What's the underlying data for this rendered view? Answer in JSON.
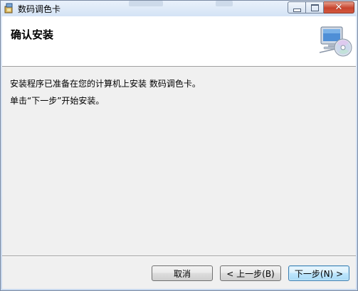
{
  "window": {
    "title": "数码调色卡",
    "controls": {
      "minimize_icon": "minimize-icon",
      "maximize_icon": "maximize-icon",
      "close_icon": "close-icon",
      "close_glyph": "✕"
    }
  },
  "banner": {
    "title": "确认安装",
    "icon": "computer-cd-icon"
  },
  "body": {
    "line1": "安装程序已准备在您的计算机上安装 数码调色卡。",
    "line2": "单击“下一步”开始安装。"
  },
  "buttons": {
    "cancel": "取消",
    "back": "< 上一步(B)",
    "next": "下一步(N) >"
  },
  "colors": {
    "titlebar": "#d4e3f5",
    "close_button": "#c8442e",
    "default_button_border": "#3c7fb1"
  }
}
